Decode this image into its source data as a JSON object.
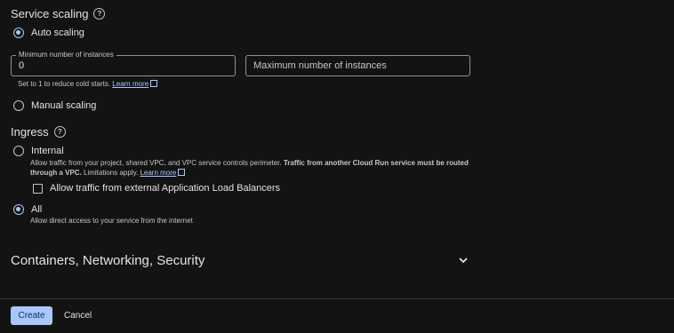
{
  "service_scaling": {
    "title": "Service scaling",
    "help_icon": "help-circle-icon",
    "auto_label": "Auto scaling",
    "min_label": "Minimum number of instances",
    "min_value": "0",
    "max_placeholder": "Maximum number of instances",
    "min_help": "Set to 1 to reduce cold starts.",
    "learn_more": "Learn more",
    "manual_label": "Manual scaling"
  },
  "ingress": {
    "title": "Ingress",
    "internal_label": "Internal",
    "internal_desc_line1_a": "Allow traffic from your project, shared VPC, and VPC service controls perimeter. ",
    "internal_desc_line1_b": "Traffic from another Cloud Run service must be routed",
    "internal_desc_line2_a": "through a VPC.",
    "internal_desc_line2_b": " Limitations apply. ",
    "learn_more": "Learn more",
    "checkbox_label": "Allow traffic from external Application Load Balancers",
    "all_label": "All",
    "all_desc": "Allow direct access to your service from the internet"
  },
  "accordion": {
    "title": "Containers, Networking, Security",
    "icon": "chevron-down-icon"
  },
  "footer": {
    "create_label": "Create",
    "cancel_label": "Cancel"
  },
  "colors": {
    "background": "#131313",
    "accent": "#a8c7fa"
  }
}
